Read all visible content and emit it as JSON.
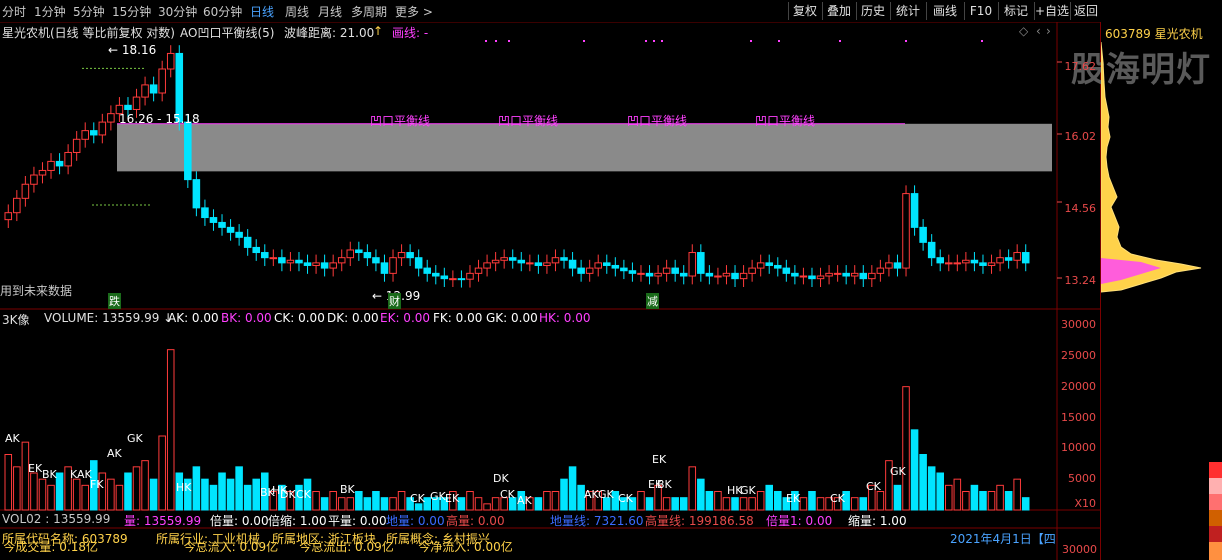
{
  "toolbar": {
    "timeframes": [
      "分时",
      "1分钟",
      "5分钟",
      "15分钟",
      "30分钟",
      "60分钟",
      "日线",
      "周线",
      "月线",
      "多周期",
      "更多 >"
    ],
    "active_timeframe": "日线",
    "buttons": [
      "复权",
      "叠加",
      "历史",
      "统计",
      "画线",
      "F10",
      "标记",
      "+自选",
      "返回"
    ]
  },
  "header": {
    "stock_name_line": "星光农机(日线 等比前复权 对数)",
    "indicator": "AO凹口平衡线(5)",
    "wave_label": "波峰距离: 21.00",
    "wave_arrow": "↑",
    "draw_line": "画线: -"
  },
  "right_panel": {
    "code_name": "603789 星光农机",
    "watermark": "股海明灯"
  },
  "price_axis": {
    "labels": [
      "17.62",
      "16.02",
      "14.56",
      "13.24"
    ]
  },
  "price_chart": {
    "high_label": "18.16",
    "range_label": "16.26 - 15.18",
    "low_label": "12.99",
    "balance_labels": [
      "凹口平衡线",
      "凹口平衡线",
      "凹口平衡线",
      "凹口平衡线"
    ],
    "no_future_data": "用到未来数据",
    "markers": [
      "跌",
      "财",
      "减"
    ],
    "bar_count": 120,
    "closes": [
      14.3,
      14.6,
      14.9,
      15.1,
      15.2,
      15.4,
      15.3,
      15.6,
      15.9,
      16.1,
      16.0,
      16.3,
      16.5,
      16.7,
      16.6,
      16.9,
      17.2,
      17.0,
      17.6,
      18.0,
      16.3,
      15.0,
      14.4,
      14.2,
      14.1,
      14.0,
      13.9,
      13.8,
      13.6,
      13.5,
      13.4,
      13.4,
      13.3,
      13.35,
      13.3,
      13.25,
      13.3,
      13.2,
      13.3,
      13.4,
      13.55,
      13.5,
      13.4,
      13.3,
      13.1,
      13.4,
      13.5,
      13.4,
      13.2,
      13.1,
      13.05,
      13.0,
      13.0,
      12.99,
      13.1,
      13.2,
      13.3,
      13.35,
      13.4,
      13.35,
      13.3,
      13.3,
      13.25,
      13.3,
      13.4,
      13.35,
      13.2,
      13.1,
      13.2,
      13.3,
      13.25,
      13.2,
      13.15,
      13.1,
      13.1,
      13.05,
      13.1,
      13.2,
      13.1,
      13.05,
      13.5,
      13.1,
      13.05,
      13.05,
      13.1,
      13.0,
      13.1,
      13.2,
      13.3,
      13.25,
      13.2,
      13.1,
      13.05,
      13.05,
      13.0,
      13.05,
      13.1,
      13.1,
      13.05,
      13.1,
      13.0,
      13.1,
      13.2,
      13.3,
      13.2,
      14.7,
      14.0,
      13.7,
      13.4,
      13.3,
      13.3,
      13.3,
      13.35,
      13.3,
      13.25,
      13.3,
      13.4,
      13.35,
      13.5,
      13.3
    ],
    "volumes": [
      9,
      7,
      11,
      6,
      5,
      4,
      6,
      7,
      5,
      4,
      8,
      6,
      5,
      4,
      6,
      7,
      8,
      5,
      12,
      26,
      6,
      5,
      7,
      5,
      4,
      6,
      5,
      7,
      4,
      5,
      6,
      3,
      4,
      3,
      4,
      5,
      3,
      2,
      3,
      2,
      2,
      3,
      2,
      3,
      2,
      2,
      3,
      2,
      1,
      2,
      2,
      2,
      3,
      2,
      3,
      2,
      1,
      2,
      2,
      2,
      3,
      2,
      2,
      3,
      3,
      5,
      7,
      4,
      3,
      3,
      2,
      3,
      2,
      2,
      3,
      2,
      4,
      2,
      2,
      2,
      7,
      5,
      3,
      3,
      2,
      2,
      2,
      2,
      3,
      4,
      3,
      2,
      3,
      2,
      3,
      2,
      2,
      2,
      3,
      2,
      2,
      4,
      3,
      8,
      4,
      20,
      13,
      9,
      7,
      6,
      4,
      5,
      3,
      4,
      3,
      3,
      4,
      3,
      5,
      2
    ]
  },
  "volume_header": {
    "title": "3K像",
    "volume": "VOLUME: 13559.99",
    "items": [
      {
        "label": "AK: 0.00",
        "color": "#ffffff"
      },
      {
        "label": "BK: 0.00",
        "color": "#ff40ff"
      },
      {
        "label": "CK: 0.00",
        "color": "#ffffff"
      },
      {
        "label": "DK: 0.00",
        "color": "#ffffff"
      },
      {
        "label": "EK: 0.00",
        "color": "#ff40ff"
      },
      {
        "label": "FK: 0.00",
        "color": "#ffffff"
      },
      {
        "label": "GK: 0.00",
        "color": "#ffffff"
      },
      {
        "label": "HK: 0.00",
        "color": "#ff40ff"
      }
    ]
  },
  "volume_axis": {
    "labels": [
      "30000",
      "25000",
      "20000",
      "15000",
      "10000",
      "5000"
    ],
    "multiplier": "X10"
  },
  "volume_signals": [
    "AK",
    "EK",
    "BK",
    "KAK",
    "FK",
    "AK",
    "GK",
    "HK",
    "BK",
    "HK",
    "DK",
    "CK",
    "BK",
    "CK",
    "GK",
    "EK",
    "DK",
    "CK",
    "AK",
    "AK",
    "GK",
    "CK",
    "EK",
    "EK",
    "BK",
    "HK",
    "GK",
    "EK",
    "CK",
    "CK",
    "GK"
  ],
  "vol02": {
    "items": [
      {
        "label": "VOL02 : 13559.99",
        "color": "#c8c8c8"
      },
      {
        "label": "量: 13559.99",
        "color": "#ff40ff"
      },
      {
        "label": "倍量: 0.00",
        "color": "#ffffff"
      },
      {
        "label": "倍缩: 1.00",
        "color": "#ffffff"
      },
      {
        "label": "平量: 0.00",
        "color": "#ffffff"
      },
      {
        "label": "地量: 0.00",
        "color": "#3a6bff"
      },
      {
        "label": "高量: 0.00",
        "color": "#e84a4a"
      },
      {
        "label": "地量线: 7321.60",
        "color": "#3a6bff"
      },
      {
        "label": "高量线: 199186.58",
        "color": "#e84a4a"
      },
      {
        "label": "倍量1: 0.00",
        "color": "#ff40ff"
      },
      {
        "label": "缩量: 1.00",
        "color": "#ffffff"
      }
    ]
  },
  "bottom_info": {
    "row1": [
      "所属代码名称: 603789",
      "所属行业: 工业机械",
      "所属地区: 浙江板块",
      "所属概念: 乡村振兴"
    ],
    "row2": [
      "今成交量: 0.18亿",
      "今总流入: 0.09亿",
      "今总流出: 0.09亿",
      "今净流入: 0.00亿"
    ],
    "date": "2021年4月1日【四",
    "bottom_axis": "30000"
  },
  "colors": {
    "up": "#ff3b3b",
    "down": "#00e5ff",
    "flat": "#ffffff",
    "magenta": "#ff40ff",
    "axis": "#e84a4a",
    "band": "#8a8a8a"
  }
}
